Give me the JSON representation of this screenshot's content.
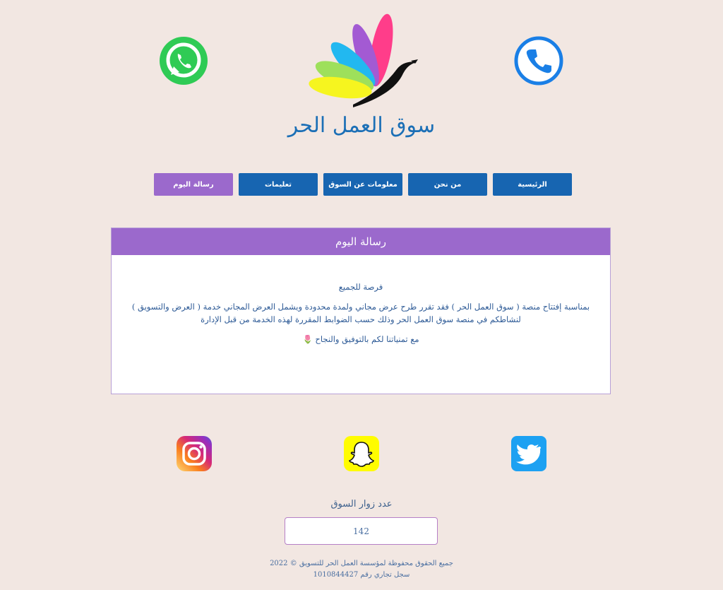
{
  "header": {
    "site_title": "سوق العمل الحر"
  },
  "nav": {
    "items": [
      {
        "label": "الرئيسية"
      },
      {
        "label": "من نحن"
      },
      {
        "label": "معلومات عن السوق"
      },
      {
        "label": "تعليمات"
      },
      {
        "label": "رسالة اليوم"
      }
    ]
  },
  "message": {
    "title": "رسالة اليوم",
    "subtitle": "فرصة للجميع",
    "body": "بمناسبة إفتتاح منصة ( سوق العمل الحر ) فقد تقرر طرح عرض مجاني ولمدة محدودة ويشمل العرض المجاني خدمة ( العرض والتسويق ) لنشاطكم في منصة سوق العمل الحر وذلك حسب الضوابط المقررة لهذه الخدمة من قبل الإدارة",
    "closing": "مع تمنياتنا لكم بالتوفيق والنجاح 🌷"
  },
  "visitors": {
    "label": "عدد زوار السوق",
    "count": "142"
  },
  "footer": {
    "copyright": "جميع الحقوق محفوظة لمؤسسة العمل الحر للتسويق © 2022",
    "registration": "سجل تجاري رقم 1010844427"
  },
  "icons": {
    "contact": [
      "whatsapp-icon",
      "phone-icon"
    ],
    "social": [
      "instagram-icon",
      "snapchat-icon",
      "twitter-icon"
    ]
  },
  "colors": {
    "background": "#f2e7e2",
    "nav_button": "#1765b1",
    "accent_purple": "#9b69cc",
    "title_blue": "#1b6fb6"
  }
}
